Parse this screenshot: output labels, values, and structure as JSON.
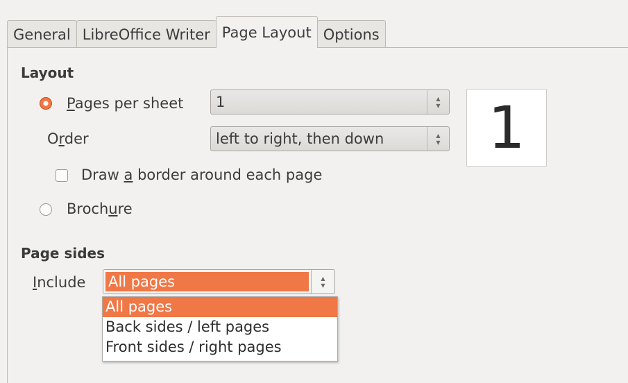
{
  "tabs": [
    {
      "label": "General",
      "active": false
    },
    {
      "label": "LibreOffice Writer",
      "active": false
    },
    {
      "label": "Page Layout",
      "active": true
    },
    {
      "label": "Options",
      "active": false
    }
  ],
  "layout": {
    "title": "Layout",
    "pages_per_sheet": {
      "label_pre": "",
      "label_mnemonic": "P",
      "label_post": "ages per sheet",
      "selected": true,
      "value": "1"
    },
    "order": {
      "label_pre": "O",
      "label_mnemonic": "r",
      "label_post": "der",
      "value": "left to right, then down"
    },
    "border": {
      "label_pre": "Draw ",
      "label_mnemonic": "a",
      "label_post": " border around each page",
      "checked": false
    },
    "brochure": {
      "label_pre": "Broch",
      "label_mnemonic": "u",
      "label_post": "re",
      "selected": false
    },
    "preview_text": "1"
  },
  "page_sides": {
    "title": "Page sides",
    "include": {
      "label_pre": "",
      "label_mnemonic": "I",
      "label_post": "nclude",
      "value": "All pages"
    },
    "options": [
      "All pages",
      "Back sides / left pages",
      "Front sides / right pages"
    ],
    "selected_index": 0
  },
  "colors": {
    "accent": "#f07746"
  }
}
